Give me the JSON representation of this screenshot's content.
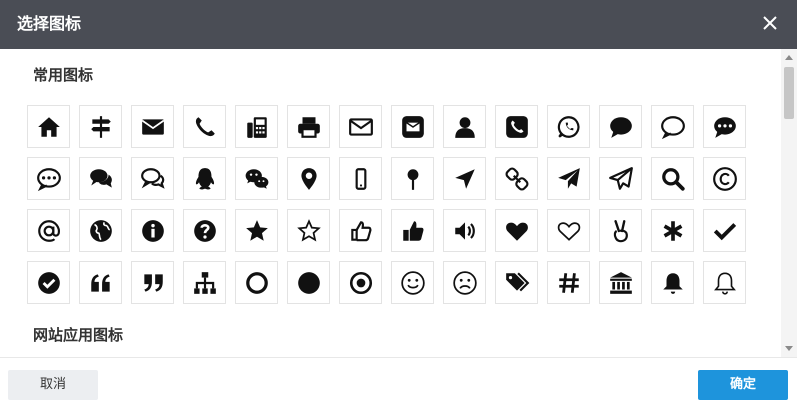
{
  "dialog": {
    "title": "选择图标",
    "close_icon": "close-icon"
  },
  "sections": [
    {
      "title": "常用图标"
    },
    {
      "title": "网站应用图标"
    }
  ],
  "icons": [
    [
      "home",
      "signpost",
      "envelope",
      "phone",
      "fax",
      "print",
      "envelope-outline",
      "envelope-square",
      "user",
      "phone-square",
      "whatsapp",
      "comment",
      "comment-outline",
      "commenting"
    ],
    [
      "commenting-outline",
      "comments",
      "comments-outline",
      "qq",
      "wechat",
      "map-marker",
      "mobile",
      "map-pin",
      "location-arrow",
      "chain",
      "paper-plane",
      "paper-plane-outline",
      "search",
      "copyright"
    ],
    [
      "at",
      "globe",
      "info-circle",
      "question-circle",
      "star",
      "star-outline",
      "thumbs-up-outline",
      "thumbs-up",
      "volume-up",
      "heart",
      "heart-outline",
      "hand-peace",
      "asterisk",
      "check"
    ],
    [
      "check-circle",
      "quote-left",
      "quote-right",
      "sitemap",
      "circle-outline",
      "circle",
      "dot-circle",
      "smile",
      "frown",
      "tags",
      "hashtag",
      "institution",
      "bell",
      "bell-outline"
    ]
  ],
  "footer": {
    "cancel_label": "取消",
    "ok_label": "确定"
  },
  "colors": {
    "header_bg": "#4a4d55",
    "ok_bg": "#1e94dc",
    "cancel_bg": "#eceef1"
  }
}
